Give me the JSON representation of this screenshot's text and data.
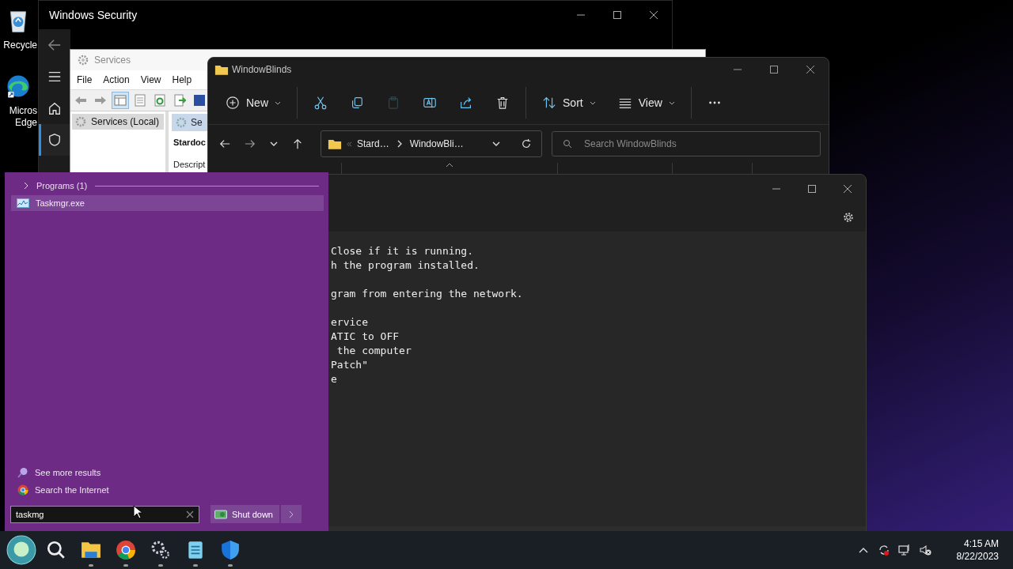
{
  "desktop_icons": [
    {
      "kind": "recycle",
      "lines": [
        "Recycle"
      ]
    },
    {
      "kind": "edge",
      "lines": [
        "Micros",
        "Edge"
      ]
    }
  ],
  "windows_security": {
    "title": "Windows Security",
    "nav": [
      {
        "kind": "back",
        "selected": false
      },
      {
        "kind": "menu",
        "selected": false
      },
      {
        "kind": "home",
        "selected": false
      },
      {
        "kind": "shield",
        "selected": true
      }
    ]
  },
  "services": {
    "title": "Services",
    "menu": [
      "File",
      "Action",
      "View",
      "Help"
    ],
    "toolbar": [
      {
        "kind": "back",
        "pressed": false
      },
      {
        "kind": "forward",
        "pressed": false
      },
      {
        "kind": "tree",
        "pressed": true
      },
      {
        "kind": "properties",
        "pressed": false
      },
      {
        "kind": "refresh",
        "pressed": false
      },
      {
        "kind": "export",
        "pressed": false
      },
      {
        "kind": "help",
        "pressed": false
      }
    ],
    "tree": [
      {
        "label": "Services (Local)",
        "selected": true
      }
    ],
    "tab": "Se",
    "heading": "Stardoc",
    "description": "Descript"
  },
  "explorer": {
    "title": "WindowBlinds",
    "toolbar_groups": [
      {
        "items": [
          {
            "kind": "new",
            "label": "New",
            "disabled": false
          }
        ]
      },
      {
        "items": [
          {
            "kind": "cut",
            "disabled": false
          },
          {
            "kind": "copy",
            "disabled": false
          },
          {
            "kind": "paste",
            "disabled": true
          },
          {
            "kind": "rename",
            "disabled": false
          },
          {
            "kind": "share",
            "disabled": false
          },
          {
            "kind": "delete",
            "disabled": false
          }
        ]
      },
      {
        "items": [
          {
            "kind": "sort",
            "label": "Sort",
            "disabled": false
          },
          {
            "kind": "view",
            "label": "View",
            "disabled": false
          }
        ]
      },
      {
        "items": [
          {
            "kind": "more",
            "disabled": false
          }
        ]
      }
    ],
    "breadcrumb": [
      "Stard…",
      "WindowBli…"
    ],
    "search": {
      "placeholder": "Search WindowBlinds"
    }
  },
  "notepad": {
    "paragraphs": [
      [
        "Close if it is running.",
        "h the program installed."
      ],
      [
        "gram from entering the network."
      ],
      [
        "ervice",
        "ATIC to OFF",
        " the computer",
        "Patch\"",
        "e"
      ]
    ]
  },
  "start_menu": {
    "section": "Programs (1)",
    "results": [
      {
        "label": "Taskmgr.exe",
        "selected": true
      }
    ],
    "links": [
      {
        "kind": "search",
        "label": "See more results"
      },
      {
        "kind": "web",
        "label": "Search the Internet"
      }
    ],
    "search": {
      "value": "taskmg"
    },
    "shutdown": "Shut down"
  },
  "taskbar": {
    "apps": [
      {
        "kind": "start",
        "running": false
      },
      {
        "kind": "search",
        "running": false
      },
      {
        "kind": "files",
        "running": true
      },
      {
        "kind": "chrome",
        "running": true
      },
      {
        "kind": "settings",
        "running": true
      },
      {
        "kind": "notepad",
        "running": true
      },
      {
        "kind": "defender",
        "running": true
      }
    ],
    "tray": [
      {
        "kind": "chevron"
      },
      {
        "kind": "sync"
      },
      {
        "kind": "network"
      },
      {
        "kind": "muted"
      }
    ],
    "clock": {
      "time": "4:15 AM",
      "date": "8/22/2023"
    }
  }
}
